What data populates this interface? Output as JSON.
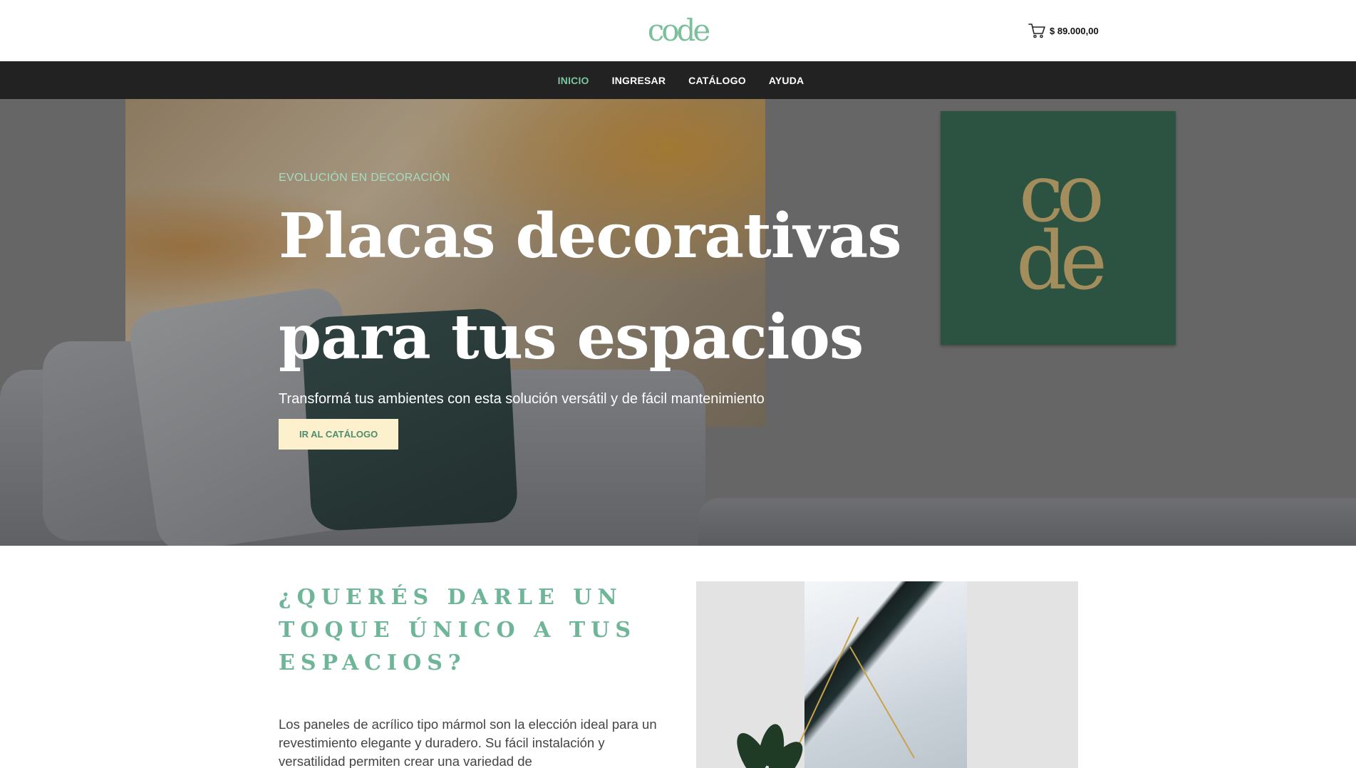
{
  "header": {
    "logo_text": "code",
    "cart_total": "$ 89.000,00",
    "cart_icon": "cart-icon"
  },
  "nav": {
    "items": [
      {
        "label": "INICIO",
        "active": true
      },
      {
        "label": "INGRESAR",
        "active": false
      },
      {
        "label": "CATÁLOGO",
        "active": false
      },
      {
        "label": "AYUDA",
        "active": false
      }
    ]
  },
  "hero": {
    "eyebrow": "EVOLUCIÓN EN DECORACIÓN",
    "title_line1": "Placas decorativas",
    "title_line2": "para tus espacios",
    "subtitle": "Transformá tus ambientes con esta solución versátil y de fácil mantenimiento",
    "cta_label": "IR AL CATÁLOGO",
    "frame_logo_line1": "co",
    "frame_logo_line2": "de"
  },
  "about": {
    "heading": "¿QUERÉS DARLE UN TOQUE ÚNICO A TUS ESPACIOS?",
    "text": "Los paneles de acrílico tipo mármol son la elección ideal para un revestimiento elegante y duradero. Su fácil instalación y versatilidad permiten crear una variedad de"
  },
  "colors": {
    "accent": "#7bc4a0",
    "nav_bg": "#222222",
    "button_bg": "#fdf0cc",
    "frame_green": "#2c5241"
  }
}
